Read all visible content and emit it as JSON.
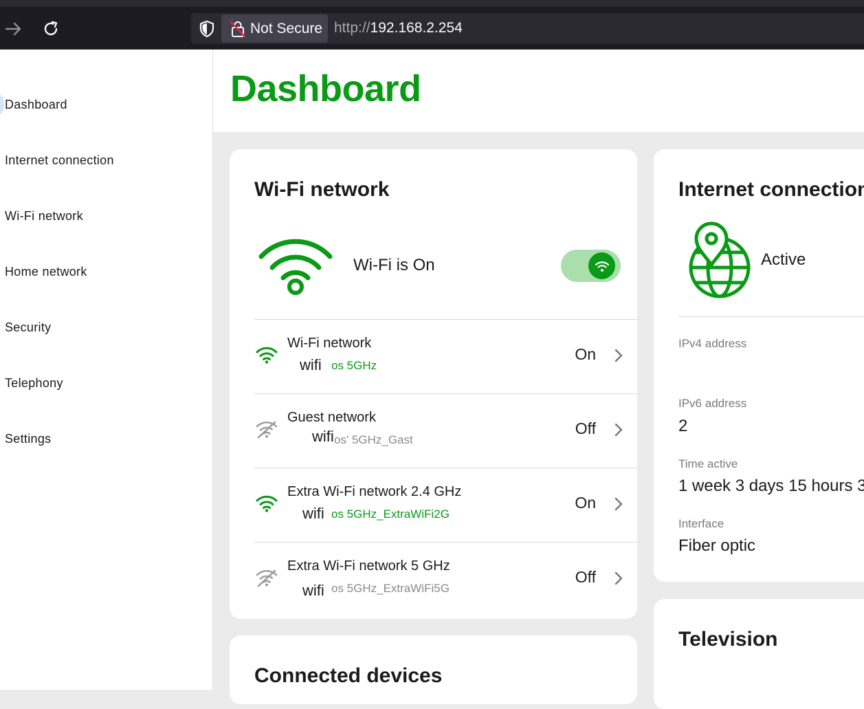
{
  "browser": {
    "security_label": "Not Secure",
    "url_scheme": "http://",
    "url_host": "192.168.2.254"
  },
  "sidebar": {
    "items": [
      {
        "label": "Dashboard"
      },
      {
        "label": "Internet connection"
      },
      {
        "label": "Wi-Fi network"
      },
      {
        "label": "Home network"
      },
      {
        "label": "Security"
      },
      {
        "label": "Telephony"
      },
      {
        "label": "Settings"
      }
    ]
  },
  "page": {
    "title": "Dashboard"
  },
  "wifi_card": {
    "title": "Wi-Fi network",
    "status": "Wi-Fi is On",
    "networks": [
      {
        "name": "Wi-Fi network",
        "prefix": "wifi",
        "ssid": "os 5GHz",
        "state": "On"
      },
      {
        "name": "Guest network",
        "prefix": "wifi",
        "ssid": "os' 5GHz_Gast",
        "state": "Off"
      },
      {
        "name": "Extra Wi-Fi network 2.4 GHz",
        "prefix": "wifi",
        "ssid": "os 5GHz_ExtraWiFi2G",
        "state": "On"
      },
      {
        "name": "Extra Wi-Fi network 5 GHz",
        "prefix": "wifi",
        "ssid": "os 5GHz_ExtraWiFi5G",
        "state": "Off"
      }
    ]
  },
  "devices_card": {
    "title": "Connected devices"
  },
  "internet_card": {
    "title": "Internet connection",
    "status": "Active",
    "ipv4_label": "IPv4 address",
    "ipv4_value": "",
    "ipv6_label": "IPv6 address",
    "ipv6_value": "2",
    "time_label": "Time active",
    "time_value": "1 week 3 days 15 hours 3",
    "interface_label": "Interface",
    "interface_value": "Fiber optic"
  },
  "tv_card": {
    "title": "Television"
  },
  "colors": {
    "brand_green": "#0a9a16",
    "toggle_track": "#a9dfac",
    "muted_text": "#8a8a8a"
  }
}
